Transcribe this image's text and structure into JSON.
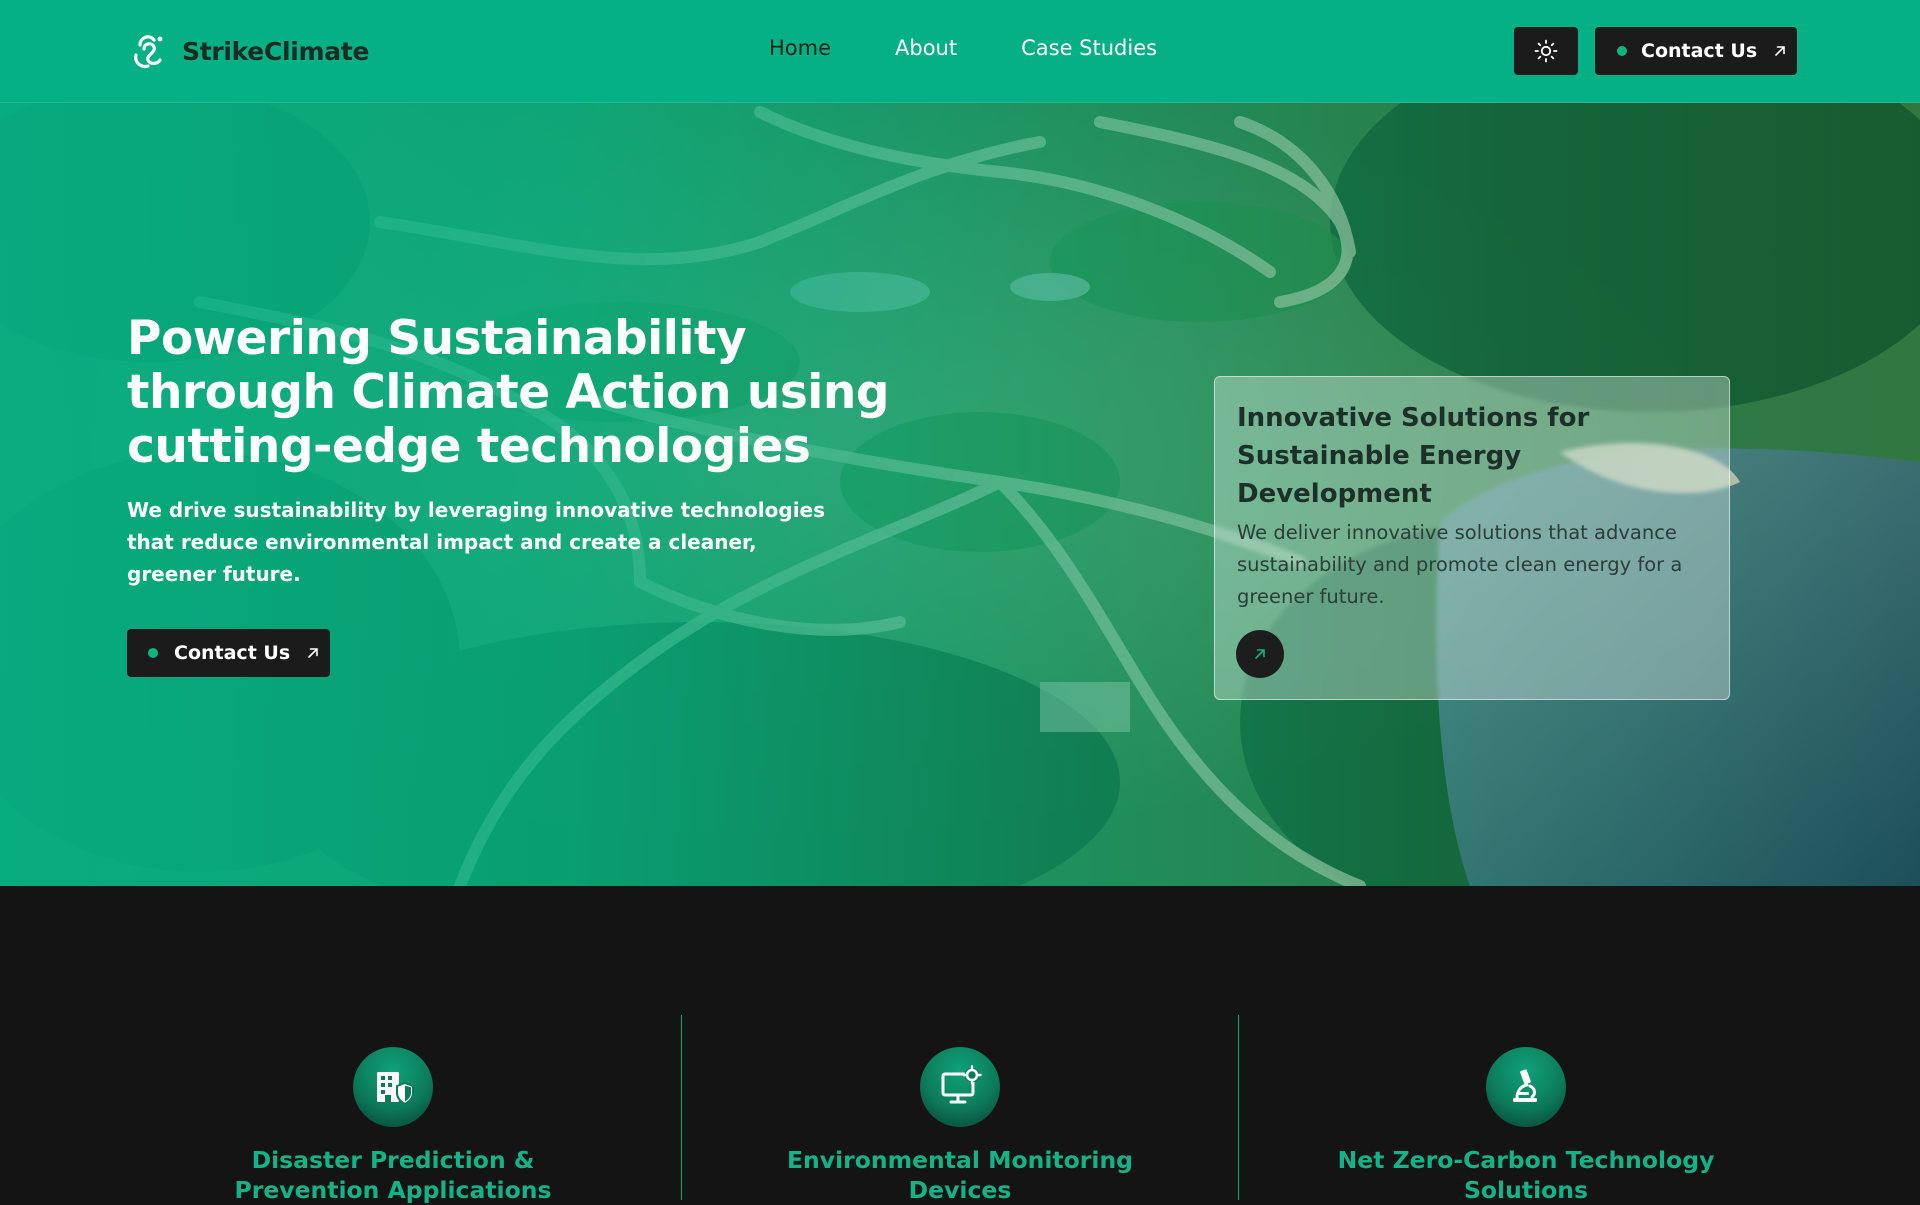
{
  "colors": {
    "accent": "#05b184",
    "dark": "#1b1b1b",
    "background": "#141414",
    "feature_title": "#13b387"
  },
  "header": {
    "logo_icon": "strikeclimate-logo-icon",
    "brand": "StrikeClimate",
    "nav": [
      "Home",
      "About",
      "Case Studies"
    ],
    "active_nav": "Home",
    "theme_toggle_icon": "sun-icon",
    "contact_label": "Contact Us"
  },
  "hero": {
    "title": "Powering Sustainability through Climate Action using cutting-edge technologies",
    "subtitle": "We drive sustainability by leveraging innovative technologies that reduce environmental impact and create a cleaner, greener future.",
    "cta_label": "Contact Us",
    "background": "aerial-forest-lake-photo",
    "card": {
      "title": "Innovative Solutions for Sustainable Energy Development",
      "text": "We deliver innovative solutions that advance sustainability and promote clean energy for a greener future.",
      "icon": "arrow-up-right-icon"
    }
  },
  "features": [
    {
      "icon": "building-shield-icon",
      "title": "Disaster Prediction & Prevention Applications"
    },
    {
      "icon": "monitor-gear-icon",
      "title": "Environmental Monitoring Devices"
    },
    {
      "icon": "microscope-icon",
      "title": "Net Zero-Carbon Technology Solutions"
    }
  ]
}
